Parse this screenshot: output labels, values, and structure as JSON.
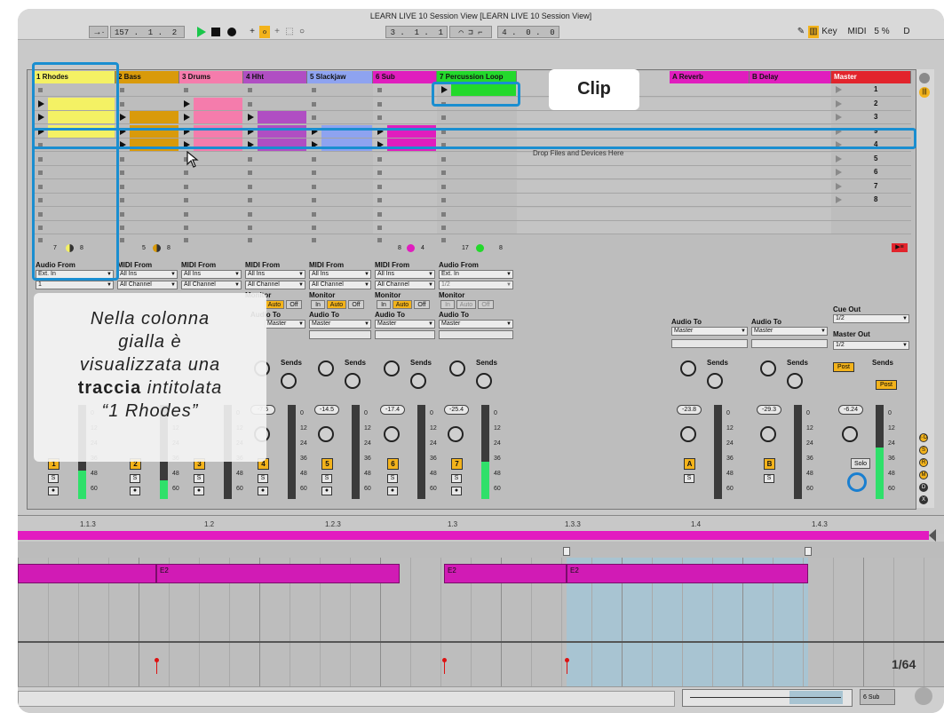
{
  "window": {
    "title": "LEARN LIVE 10 Session View  [LEARN LIVE 10 Session View]"
  },
  "toolbar": {
    "tempo": "157 .  1 .  2",
    "position": "3 .  1 .  1",
    "loop_length": "4 .  0 .  0",
    "key_label": "Key",
    "midi_label": "MIDI",
    "cpu": "5 %",
    "d_label": "D"
  },
  "tracks": [
    {
      "name": "1 Rhodes",
      "color": "#f4f164"
    },
    {
      "name": "2 Bass",
      "color": "#d99a0a"
    },
    {
      "name": "3 Drums",
      "color": "#f57cac"
    },
    {
      "name": "4 Hht",
      "color": "#b04ec3"
    },
    {
      "name": "5 Slackjaw",
      "color": "#8ea3f0"
    },
    {
      "name": "6 Sub",
      "color": "#e01dbe"
    },
    {
      "name": "7 Percussion Loop",
      "color": "#23d92b"
    },
    {
      "name": "A Reverb",
      "color": "#e01dbe"
    },
    {
      "name": "B Delay",
      "color": "#e01dbe"
    },
    {
      "name": "Master",
      "color": "#e2242c"
    }
  ],
  "io": {
    "audio_from": "Audio From",
    "midi_from": "MIDI From",
    "ext_in": "Ext. In",
    "all_ins": "All Ins",
    "all_channels": "All Channel",
    "one": "1",
    "one_two": "1/2",
    "monitor": "Monitor",
    "in": "In",
    "auto": "Auto",
    "off": "Off",
    "audio_to": "Audio To",
    "master": "Master",
    "cue_out": "Cue Out",
    "master_out": "Master Out",
    "sends": "Sends",
    "post": "Post",
    "solo": "Solo",
    "s": "S"
  },
  "rows_footer": {
    "a": "7",
    "b": "8",
    "c": "5",
    "d": "8",
    "e": "8",
    "f": "4",
    "g": "17",
    "h": "8"
  },
  "volumes": {
    "t4": "-7.5",
    "t5": "-14.5",
    "t6": "-17.4",
    "t7": "-25.4",
    "ra": "-23.8",
    "rb": "-29.3",
    "m": "-6.24"
  },
  "meter_scale": [
    "0",
    "12",
    "24",
    "36",
    "48",
    "60"
  ],
  "track_numbers": [
    "1",
    "2",
    "3",
    "4",
    "5",
    "6",
    "7",
    "A",
    "B"
  ],
  "scenes": [
    "1",
    "2",
    "3",
    "9",
    "4",
    "5",
    "6",
    "7",
    "8"
  ],
  "drop_hint": "Drop Files and Devices Here",
  "callout_clip": "Clip",
  "overlay_note": {
    "line1": "Nella colonna",
    "line2": "gialla è",
    "line3": "visualizzata una",
    "bold": "traccia",
    "line4": " intitolata",
    "line5": "“1 Rhodes”"
  },
  "arrangement": {
    "ruler": [
      "1.1.3",
      "1.2",
      "1.2.3",
      "1.3",
      "1.3.3",
      "1.4",
      "1.4.3"
    ],
    "notes": [
      "E2",
      "E2",
      "E2"
    ],
    "page": "1/64"
  },
  "status": {
    "track": "6 Sub"
  }
}
